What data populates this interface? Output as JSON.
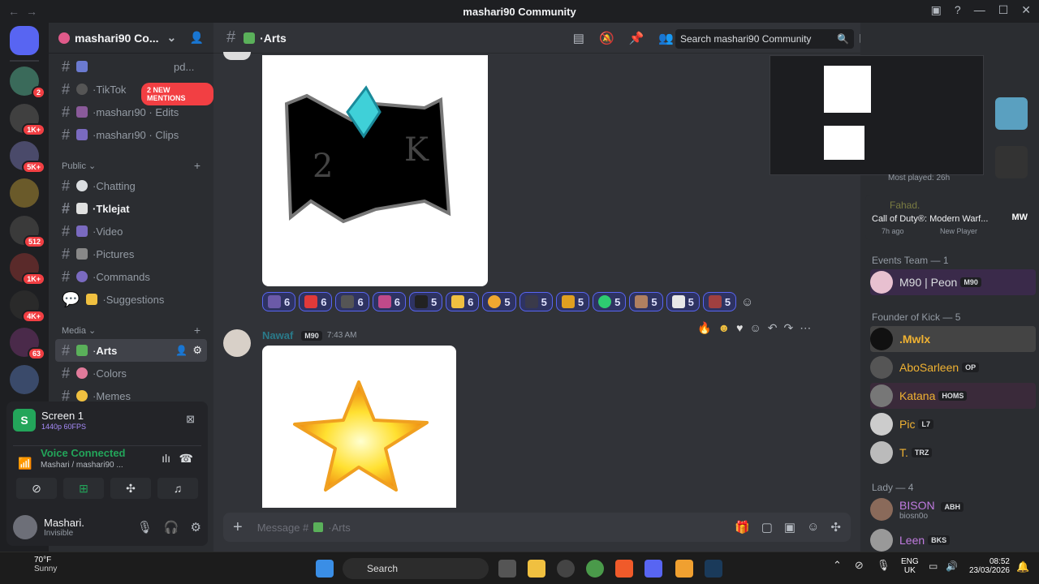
{
  "window": {
    "title": "mashari90 Community"
  },
  "guild": {
    "name": "mashari90 Co...",
    "mentions_banner": "2 NEW MENTIONS"
  },
  "channels": {
    "partial_top": "pd...",
    "items": [
      {
        "name": "TikTok"
      },
      {
        "name": "masharı90 · Edits"
      },
      {
        "name": "masharı90 · Clips"
      }
    ],
    "public_label": "Public",
    "public_items": [
      {
        "name": "Chatting"
      },
      {
        "name": "Tklejat"
      },
      {
        "name": "Video"
      },
      {
        "name": "Pictures"
      },
      {
        "name": "Commands"
      },
      {
        "name": "Suggestions"
      }
    ],
    "media_label": "Media",
    "media_items": [
      {
        "name": "Arts"
      },
      {
        "name": "Colors"
      },
      {
        "name": "Memes"
      }
    ]
  },
  "servers_badges": [
    "2",
    "1K+",
    "5K+",
    "512",
    "1K+",
    "4K+",
    "63"
  ],
  "voice": {
    "screen_title": "Screen 1",
    "screen_quality": "1440p 60FPS",
    "status": "Voice Connected",
    "location": "Mashari / mashari90 ..."
  },
  "user": {
    "name": "Mashari.",
    "status": "Invisible"
  },
  "chat": {
    "channel": "Arts",
    "search_placeholder": "Search mashari90 Community",
    "composer_placeholder": "Message #",
    "composer_channel": "Arts",
    "message": {
      "author": "Nawaf",
      "role_tag": "M90",
      "time": "7:43 AM"
    },
    "reactions": [
      {
        "count": "6",
        "color": "#6b5aa8"
      },
      {
        "count": "6",
        "color": "#e03a3a"
      },
      {
        "count": "6",
        "color": "#555"
      },
      {
        "count": "6",
        "color": "#c04a8a"
      },
      {
        "count": "5",
        "color": "#222"
      },
      {
        "count": "6",
        "color": "#f0c040"
      },
      {
        "count": "5",
        "color": "#f0a830"
      },
      {
        "count": "5",
        "color": "#3a3a4a"
      },
      {
        "count": "5",
        "color": "#e0a020"
      },
      {
        "count": "5",
        "color": "#2ecc71"
      },
      {
        "count": "5",
        "color": "#b08060"
      },
      {
        "count": "5",
        "color": "#e8e8e8"
      },
      {
        "count": "5",
        "color": "#a04040"
      }
    ]
  },
  "members": {
    "activity_most_played": "Most played: 26h",
    "activity_user": "Fahad.",
    "activity_game": "Call of Duty®: Modern Warf...",
    "activity_time": "7h ago",
    "activity_badge": "New Player",
    "group_events": "Events Team — 1",
    "group_kick": "Founder of Kick — 5",
    "group_lady": "Lady — 4",
    "list": [
      {
        "name": "M90 | Peon",
        "tag": "M90",
        "color": "#dbdee1"
      },
      {
        "name": ".Mwlx",
        "tag": "",
        "color": "#f0b232"
      },
      {
        "name": "AboSarleen",
        "tag": "OP",
        "color": "#f0b232"
      },
      {
        "name": "Katana",
        "tag": "HOMS",
        "color": "#f0b232"
      },
      {
        "name": "Pic",
        "tag": "L7",
        "color": "#f0b232"
      },
      {
        "name": "T.",
        "tag": "TRZ",
        "color": "#f0b232"
      },
      {
        "name": "BISON",
        "tag": "ABH",
        "color": "#c07be0"
      },
      {
        "name": "Leen",
        "tag": "BKS",
        "color": "#c07be0"
      }
    ],
    "bison_sub": "biosn0o"
  },
  "taskbar": {
    "weather_temp": "70°F",
    "weather_desc": "Sunny",
    "search": "Search",
    "lang": "ENG",
    "region": "UK",
    "time": "08:52",
    "date": "23/03/2026"
  }
}
